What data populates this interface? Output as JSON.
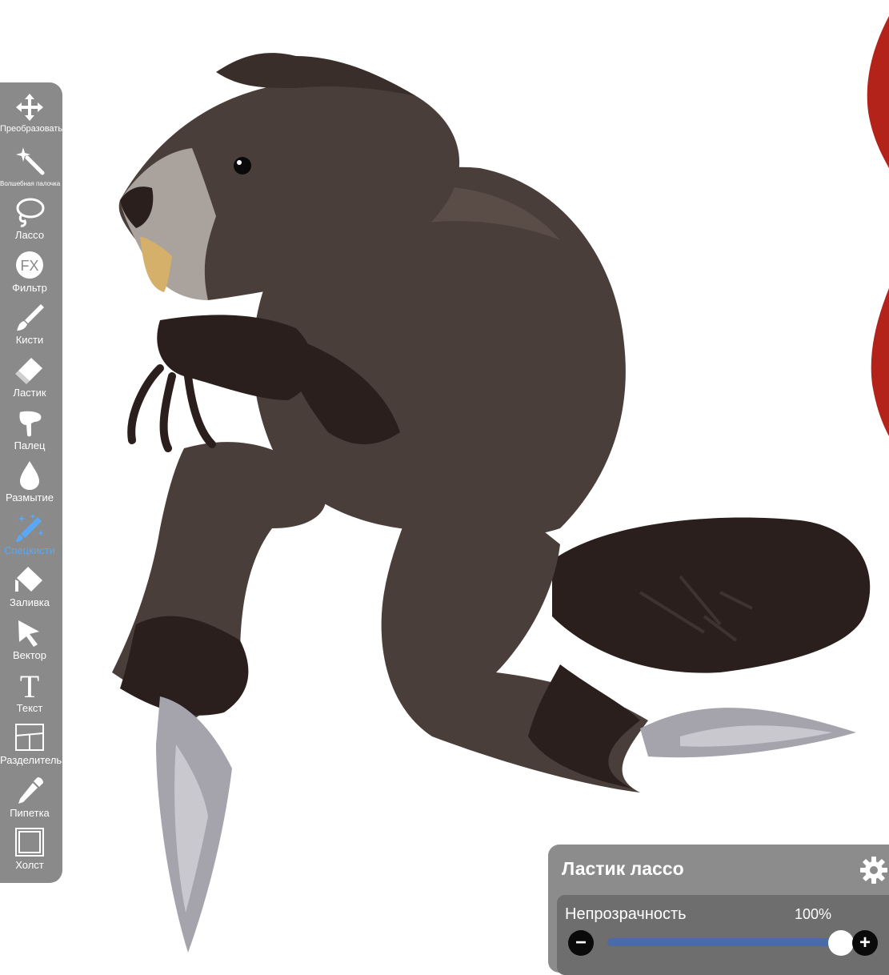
{
  "toolbar": {
    "items": [
      {
        "id": "transform",
        "label": "Преобразовать",
        "icon": "move-arrows-icon"
      },
      {
        "id": "magic-wand",
        "label": "Волшебная палочка",
        "icon": "magic-wand-icon"
      },
      {
        "id": "lasso",
        "label": "Лассо",
        "icon": "lasso-icon"
      },
      {
        "id": "filter",
        "label": "Фильтр",
        "icon": "fx-icon"
      },
      {
        "id": "brush",
        "label": "Кисти",
        "icon": "brush-icon"
      },
      {
        "id": "eraser",
        "label": "Ластик",
        "icon": "eraser-icon"
      },
      {
        "id": "smudge",
        "label": "Палец",
        "icon": "finger-icon"
      },
      {
        "id": "blur",
        "label": "Размытие",
        "icon": "drop-icon"
      },
      {
        "id": "special-brush",
        "label": "Спецкисти",
        "icon": "sparkle-brush-icon",
        "active": true
      },
      {
        "id": "fill",
        "label": "Заливка",
        "icon": "fill-bucket-icon"
      },
      {
        "id": "vector",
        "label": "Вектор",
        "icon": "cursor-arrow-icon"
      },
      {
        "id": "text",
        "label": "Текст",
        "icon": "text-t-icon"
      },
      {
        "id": "divider",
        "label": "Разделитель",
        "icon": "panel-divider-icon"
      },
      {
        "id": "eyedropper",
        "label": "Пипетка",
        "icon": "eyedropper-icon"
      },
      {
        "id": "canvas",
        "label": "Холст",
        "icon": "canvas-frame-icon"
      }
    ],
    "active_color": "#5aa8f5"
  },
  "panel": {
    "title": "Ластик лассо",
    "settings_icon": "gear-icon",
    "opacity_label": "Непрозрачность",
    "opacity_value": "100%",
    "opacity_fraction": 1.0,
    "minus_label": "−",
    "plus_label": "+"
  },
  "colors": {
    "toolbar_bg": "#8a8a8a",
    "panel_bg": "#8c8c8c",
    "slider": "#4a6ba8"
  }
}
